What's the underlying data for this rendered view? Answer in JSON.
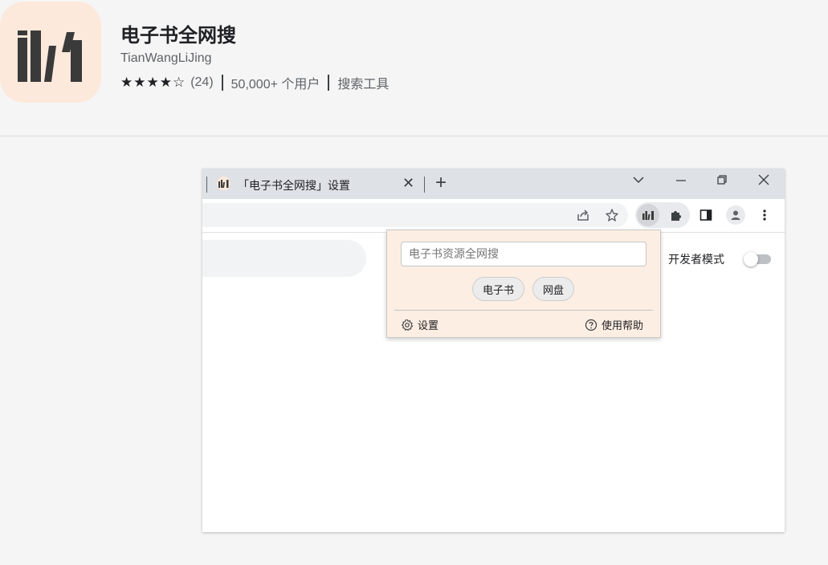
{
  "extension": {
    "title": "电子书全网搜",
    "developer": "TianWangLiJing",
    "stars": "★★★★☆",
    "rating_count": "(24)",
    "users": "50,000+ 个用户",
    "category": "搜索工具",
    "icon": "books-logo-icon"
  },
  "browser": {
    "tab_title": "「电子书全网搜」设置",
    "tab_close": "✕",
    "new_tab": "+",
    "window_controls": {
      "dropdown": "⌵",
      "minimize": "–",
      "restore": "⧉",
      "close": "✕"
    },
    "toolbar_icons": [
      "share-icon",
      "star-icon",
      "extension-icon",
      "puzzle-icon",
      "side-panel-icon",
      "profile-icon",
      "menu-icon"
    ],
    "dev_mode_label": "开发者模式",
    "dev_mode_on": false
  },
  "popup": {
    "search_placeholder": "电子书资源全网搜",
    "search_value": "",
    "buttons": {
      "ebook": "电子书",
      "netdisk": "网盘"
    },
    "settings_label": "设置",
    "help_label": "使用帮助"
  },
  "colors": {
    "page_bg": "#f5f5f5",
    "icon_bg": "#fde9dc",
    "popup_bg": "#fdeee3",
    "tabbar_bg": "#dee1e6"
  }
}
